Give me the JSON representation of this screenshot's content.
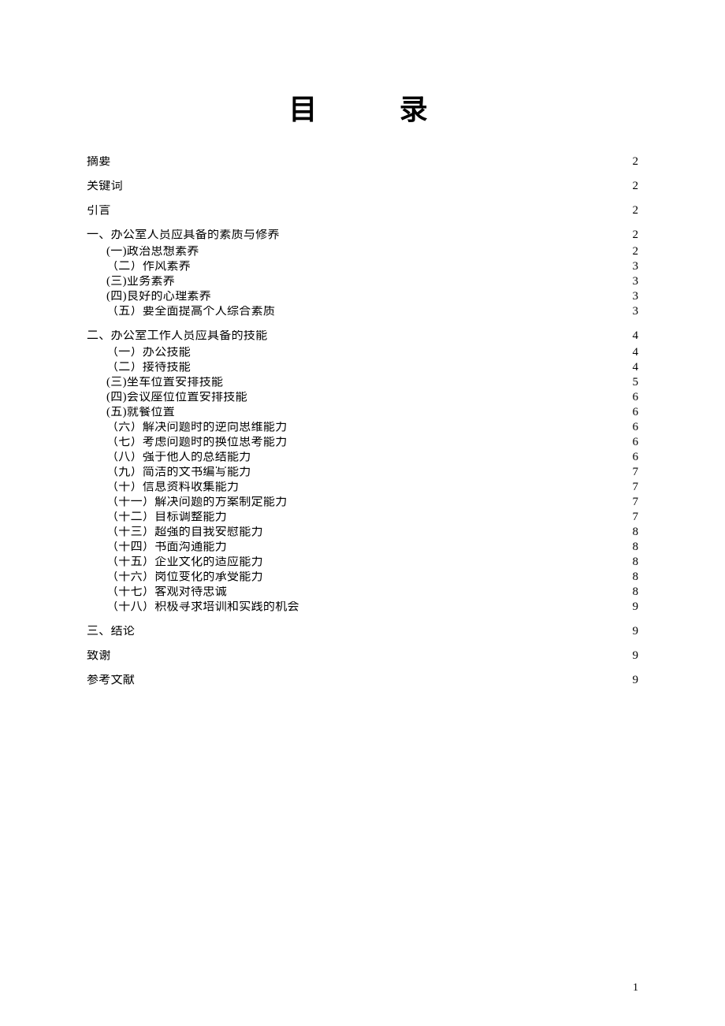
{
  "title": "目　　录",
  "page_number": "1",
  "toc": [
    {
      "level": 1,
      "label": "摘要",
      "page": "2"
    },
    {
      "level": 1,
      "label": "关键词",
      "page": "2"
    },
    {
      "level": 1,
      "label": "引言",
      "page": "2"
    },
    {
      "level": 1,
      "label": "一、办公室人员应具备的素质与修养",
      "page": "2"
    },
    {
      "level": 2,
      "label": "(一)政治思想素养",
      "page": "2"
    },
    {
      "level": 2,
      "label": "（二）作风素养",
      "page": "3"
    },
    {
      "level": 2,
      "label": "(三)业务素养",
      "page": "3"
    },
    {
      "level": 2,
      "label": "(四)良好的心理素养",
      "page": "3"
    },
    {
      "level": 2,
      "label": "（五）要全面提高个人综合素质",
      "page": "3"
    },
    {
      "level": 1,
      "label": "二、办公室工作人员应具备的技能",
      "page": "4"
    },
    {
      "level": 2,
      "label": "（一）办公技能",
      "page": "4"
    },
    {
      "level": 2,
      "label": "（二）接待技能",
      "page": "4"
    },
    {
      "level": 2,
      "label": "(三)坐车位置安排技能",
      "page": "5"
    },
    {
      "level": 2,
      "label": "(四)会议座位位置安排技能",
      "page": "6"
    },
    {
      "level": 2,
      "label": "(五)就餐位置",
      "page": "6"
    },
    {
      "level": 2,
      "label": "（六）解决问题时的逆向思维能力",
      "page": "6"
    },
    {
      "level": 2,
      "label": "（七）考虑问题时的换位思考能力",
      "page": "6"
    },
    {
      "level": 2,
      "label": "（八）强于他人的总结能力",
      "page": "6"
    },
    {
      "level": 2,
      "label": "（九）简洁的文书编写能力",
      "page": "7"
    },
    {
      "level": 2,
      "label": "（十）信息资料收集能力",
      "page": "7"
    },
    {
      "level": 2,
      "label": "（十一）解决问题的方案制定能力",
      "page": "7"
    },
    {
      "level": 2,
      "label": "（十二）目标调整能力",
      "page": "7"
    },
    {
      "level": 2,
      "label": "（十三）超强的自我安慰能力",
      "page": "8"
    },
    {
      "level": 2,
      "label": "（十四）书面沟通能力",
      "page": "8"
    },
    {
      "level": 2,
      "label": "（十五）企业文化的适应能力",
      "page": "8"
    },
    {
      "level": 2,
      "label": "（十六）岗位变化的承受能力",
      "page": "8"
    },
    {
      "level": 2,
      "label": "（十七）客观对待忠诚",
      "page": "8"
    },
    {
      "level": 2,
      "label": "（十八）积极寻求培训和实践的机会",
      "page": "9"
    },
    {
      "level": 1,
      "label": "三、结论",
      "page": "9"
    },
    {
      "level": 1,
      "label": "致谢",
      "page": "9"
    },
    {
      "level": 1,
      "label": "参考文献",
      "page": "9"
    }
  ]
}
